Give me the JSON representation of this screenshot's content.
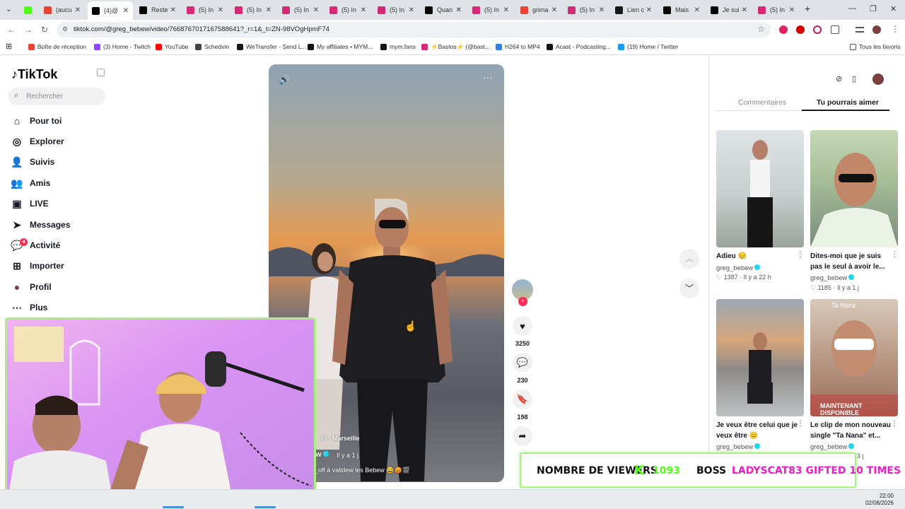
{
  "browser": {
    "tabs": [
      {
        "label": "",
        "favicon": "kick-icon",
        "color": "#53fc18"
      },
      {
        "label": "(aucu",
        "favicon": "gmail-icon",
        "color": "#ea4335"
      },
      {
        "label": "(4)@",
        "favicon": "tiktok-icon",
        "color": "#000000",
        "active": true
      },
      {
        "label": "Reste",
        "favicon": "tiktok-icon",
        "color": "#000000"
      },
      {
        "label": "(5) In",
        "favicon": "instagram-icon",
        "color": "#d62976"
      },
      {
        "label": "(5) In",
        "favicon": "instagram-icon",
        "color": "#d62976"
      },
      {
        "label": "(5) In",
        "favicon": "instagram-icon",
        "color": "#d62976"
      },
      {
        "label": "(5) In",
        "favicon": "instagram-icon",
        "color": "#d62976"
      },
      {
        "label": "(5) In",
        "favicon": "instagram-icon",
        "color": "#d62976"
      },
      {
        "label": "Quan",
        "favicon": "tiktok-icon",
        "color": "#000000"
      },
      {
        "label": "(5) In",
        "favicon": "instagram-icon",
        "color": "#d62976"
      },
      {
        "label": "grima",
        "favicon": "gmail-icon",
        "color": "#ea4335"
      },
      {
        "label": "(5) In",
        "favicon": "instagram-icon",
        "color": "#d62976"
      },
      {
        "label": "Lien c",
        "favicon": "wetransfer-icon",
        "color": "#17181a"
      },
      {
        "label": "Mais",
        "favicon": "tiktok-icon",
        "color": "#000000"
      },
      {
        "label": "Je sui",
        "favicon": "tiktok-icon",
        "color": "#000000"
      },
      {
        "label": "(5) In",
        "favicon": "instagram-icon",
        "color": "#d62976"
      }
    ],
    "url": "tiktok.com/@greg_bebew/video/7668767017167588641?_r=1&_t=ZN-98VOgHpmF74",
    "bookmarks": [
      {
        "label": "Boîte de réception",
        "favicon": "gmail-icon",
        "color": "#ea4335"
      },
      {
        "label": "(3) Home - Twitch",
        "favicon": "twitch-icon",
        "color": "#9146ff"
      },
      {
        "label": "YouTube",
        "favicon": "youtube-icon",
        "color": "#ff0000"
      },
      {
        "label": "Schedvin",
        "favicon": "dash-icon",
        "color": "#444444"
      },
      {
        "label": "WeTransfer - Send L...",
        "favicon": "wetransfer-icon",
        "color": "#17181a"
      },
      {
        "label": "My affiliates • MYM...",
        "favicon": "mym-icon",
        "color": "#111111"
      },
      {
        "label": "mym.fans",
        "favicon": "mym-icon",
        "color": "#111111"
      },
      {
        "label": "⚡Bastos⚡ (@bast...",
        "favicon": "instagram-icon",
        "color": "#d62976"
      },
      {
        "label": "H264 to MP4",
        "favicon": "video-icon",
        "color": "#2b7de9"
      },
      {
        "label": "Acast - Podcasting...",
        "favicon": "acast-icon",
        "color": "#111111"
      },
      {
        "label": "(19) Home / Twitter",
        "favicon": "twitter-icon",
        "color": "#1d9bf0"
      }
    ],
    "all_bookmarks": "Tous les favoris"
  },
  "tiktok": {
    "logo": "TikTok",
    "search_placeholder": "Rechercher",
    "nav": [
      {
        "label": "Pour toi",
        "icon": "home-icon"
      },
      {
        "label": "Explorer",
        "icon": "compass-icon"
      },
      {
        "label": "Suivis",
        "icon": "following-icon"
      },
      {
        "label": "Amis",
        "icon": "friends-icon"
      },
      {
        "label": "LIVE",
        "icon": "live-icon"
      },
      {
        "label": "Messages",
        "icon": "messages-icon"
      },
      {
        "label": "Activité",
        "icon": "activity-icon",
        "badge": "4"
      },
      {
        "label": "Importer",
        "icon": "upload-icon"
      },
      {
        "label": "Profil",
        "icon": "avatar-icon"
      },
      {
        "label": "Plus",
        "icon": "more-icon"
      }
    ],
    "video": {
      "location": "ol - Marseille",
      "author": "ew",
      "time": "Il y a 1 j",
      "caption": "ff_off à validew les Bebew 😂😡🎬"
    },
    "actions": {
      "likes": "3250",
      "comments": "230",
      "saves": "198"
    },
    "panel": {
      "tabs": [
        "Commentaires",
        "Tu pourrais aimer"
      ],
      "active_tab": "Tu pourrais aimer",
      "cards": [
        {
          "title": "Adieu 😔",
          "author": "greg_bebew",
          "stats": "♡ 1387 · Il y a 22 h"
        },
        {
          "title": "Dites-moi que je suis pas le seul à avoir le...",
          "author": "greg_bebew",
          "stats": "♡ 1185 · Il y a 1 j"
        },
        {
          "title": "Je veux être celui que je veux être 😑",
          "author": "greg_bebew",
          "stats": ""
        },
        {
          "title": "Le clip de mon nouveau single \"Ta Nana\" et...",
          "author": "greg_bebew",
          "stats": "3 j"
        }
      ],
      "thumb4_text": "MAINTENANT DISPONIBLE",
      "thumb4_top": "Ta Nana"
    }
  },
  "overlay": {
    "viewers_label": "NOMBRE DE VIEWERS",
    "viewers_count": "1093",
    "boss": "BOSS",
    "gifted": "LADYSCAT83 GIFTED 10 TIMES",
    "accent": "#53fc18",
    "gifted_color": "#e91ec7"
  },
  "taskbar": {
    "time": "22:00",
    "date": "02/08/2026"
  }
}
